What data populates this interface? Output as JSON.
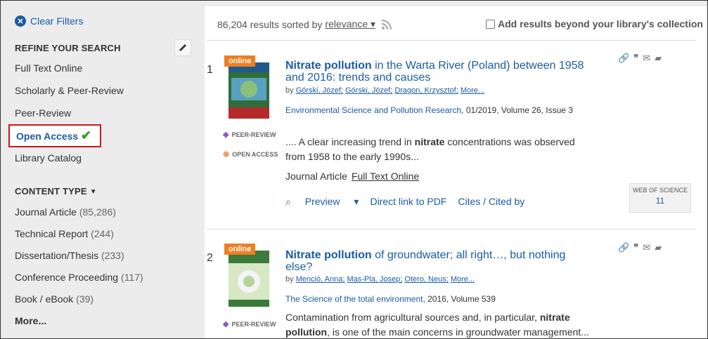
{
  "sidebar": {
    "clear_filters": "Clear Filters",
    "refine_title": "REFINE YOUR SEARCH",
    "refine_items": [
      {
        "label": "Full Text Online"
      },
      {
        "label": "Scholarly & Peer-Review"
      },
      {
        "label": "Peer-Review"
      },
      {
        "label": "Open Access",
        "selected": true
      },
      {
        "label": "Library Catalog"
      }
    ],
    "content_type_title": "CONTENT TYPE",
    "content_types": [
      {
        "label": "Journal Article",
        "count": "(85,286)"
      },
      {
        "label": "Technical Report",
        "count": "(244)"
      },
      {
        "label": "Dissertation/Thesis",
        "count": "(233)"
      },
      {
        "label": "Conference Proceeding",
        "count": "(117)"
      },
      {
        "label": "Book / eBook",
        "count": "(39)"
      }
    ],
    "more": "More..."
  },
  "main": {
    "results_text": "86,204 results sorted by",
    "sort_label": "relevance",
    "beyond_label": "Add results beyond your library's collection",
    "results": [
      {
        "num": "1",
        "badge": "online",
        "title_bold": "Nitrate pollution",
        "title_rest": " in the Warta River (Poland) between 1958 and 2016: trends and causes",
        "authors_prefix": "by ",
        "authors": [
          "Górski, Józef;",
          "Górski, Józef;",
          "Dragon, Krzysztof;",
          "More..."
        ],
        "source_link": "Environmental Science and Pollution Research",
        "source_rest": ", 01/2019, Volume 26, Issue 3",
        "snippet_pre": ".... A clear increasing trend in ",
        "snippet_bold": "nitrate",
        "snippet_post": " concentrations was observed from 1958 to the early 1990s...",
        "doc_type": "Journal Article",
        "full_text": "Full Text Online",
        "preview": "Preview",
        "pdf": "Direct link to PDF",
        "cites": "Cites / Cited by",
        "peer_review": "PEER-REVIEW",
        "open_access": "OPEN ACCESS",
        "wos_label": "WEB OF SCIENCE",
        "wos_count": "11"
      },
      {
        "num": "2",
        "badge": "online",
        "title_bold": "Nitrate pollution",
        "title_rest": " of groundwater; all right…, but nothing else?",
        "authors_prefix": "by ",
        "authors": [
          "Menció, Anna;",
          "Mas-Pla, Josep;",
          "Otero, Neus;",
          "More..."
        ],
        "source_link": "The Science of the total environment",
        "source_rest": ", 2016, Volume 539",
        "snippet_pre": "Contamination from agricultural sources and, in particular, ",
        "snippet_bold": "nitrate pollution",
        "snippet_post": ", is one of the main concerns in groundwater management...",
        "peer_review": "PEER-REVIEW"
      }
    ]
  },
  "colors": {
    "link": "#1a5ca3",
    "highlight_border": "#d0141d",
    "check": "#3a9a2a",
    "badge": "#ee7e22"
  },
  "icons": [
    "clear-icon",
    "pencil-icon",
    "chevron-down-icon",
    "rss-icon",
    "link-icon",
    "quote-icon",
    "email-icon",
    "folder-add-icon",
    "search-icon"
  ]
}
